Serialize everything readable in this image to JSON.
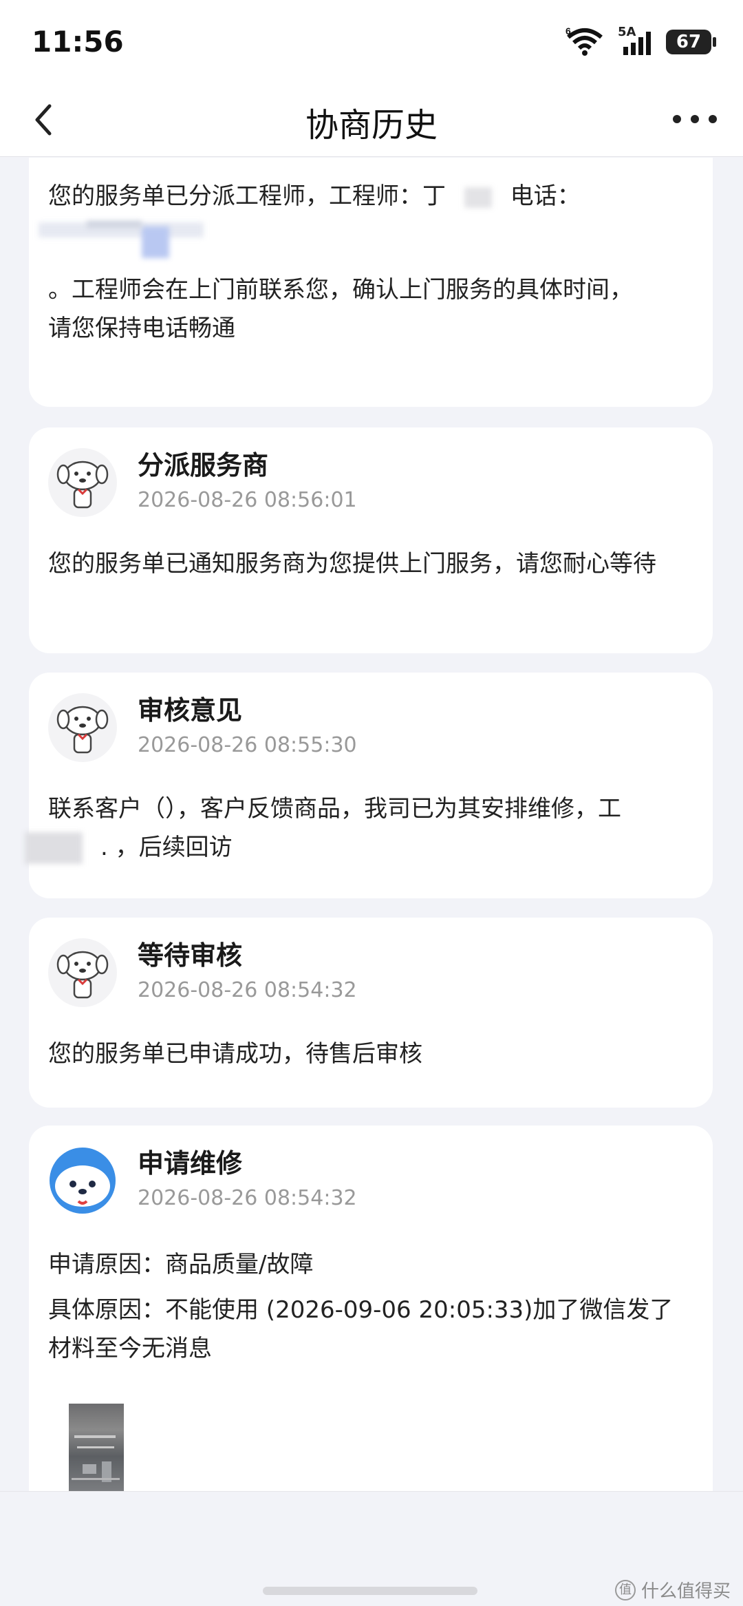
{
  "status_bar": {
    "time": "11:56",
    "wifi_label": "6",
    "signal_label": "5A",
    "battery": "67"
  },
  "nav": {
    "title": "协商历史",
    "back_icon": "chevron-left-icon",
    "more_icon": "more-dots-icon"
  },
  "cards": [
    {
      "lines": [
        "您的服务单已分派工程师，工程师：丁",
        "电话：",
        "。工程师会在上门前联系您，确认上门服务的具体时间，",
        "请您保持电话畅通"
      ]
    },
    {
      "title": "分派服务商",
      "time": "2026-08-26 08:56:01",
      "text": "您的服务单已通知服务商为您提供上门服务，请您耐心等待",
      "avatar": "mascot-gray"
    },
    {
      "title": "审核意见",
      "time": "2026-08-26 08:55:30",
      "text_line1": "联系客户（），客户反馈商品，我司已为其安排维修，工",
      "text_line2": ". ，后续回访",
      "avatar": "mascot-gray"
    },
    {
      "title": "等待审核",
      "time": "2026-08-26 08:54:32",
      "text": "您的服务单已申请成功，待售后审核",
      "avatar": "mascot-gray"
    },
    {
      "title": "申请维修",
      "time": "2026-08-26 08:54:32",
      "reason": "申请原因：商品质量/故障",
      "detail": "具体原因：不能使用 (2026-09-06 20:05:33)加了微信发了材料至今无消息",
      "avatar": "mascot-blue"
    }
  ],
  "watermark": "什么值得买",
  "colors": {
    "background": "#f2f3f8",
    "card": "#ffffff",
    "muted": "#999999",
    "brand_blue": "#3a8ee6"
  }
}
